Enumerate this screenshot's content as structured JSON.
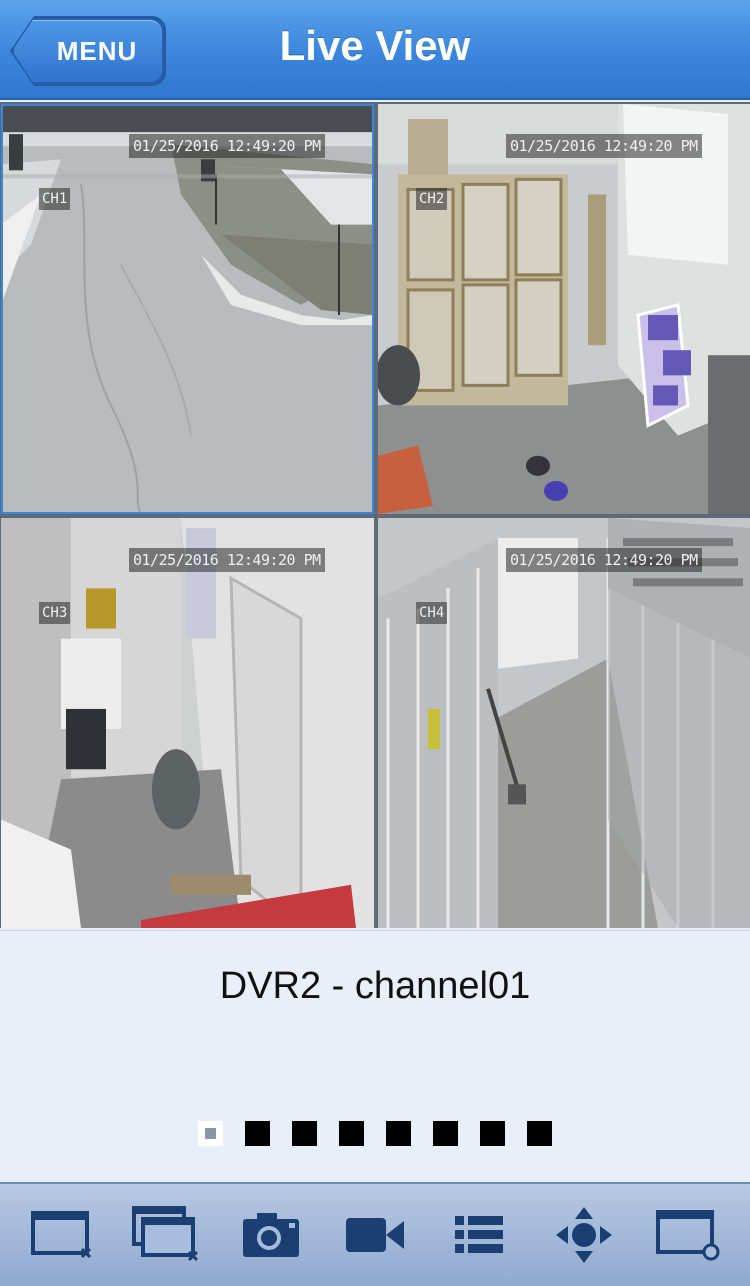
{
  "header": {
    "menu_label": "MENU",
    "title": "Live View"
  },
  "cameras": [
    {
      "timestamp": "01/25/2016 12:49:20 PM",
      "channel": "CH1"
    },
    {
      "timestamp": "01/25/2016 12:49:20 PM",
      "channel": "CH2"
    },
    {
      "timestamp": "01/25/2016 12:49:20 PM",
      "channel": "CH3"
    },
    {
      "timestamp": "01/25/2016 12:49:20 PM",
      "channel": "CH4"
    }
  ],
  "info": {
    "channel_name": "DVR2 - channel01",
    "page_count": 8,
    "active_page": 1
  },
  "toolbar": {
    "icons": [
      "close-window-icon",
      "close-all-windows-icon",
      "snapshot-camera-icon",
      "record-video-icon",
      "channel-list-icon",
      "ptz-control-icon",
      "window-settings-icon"
    ]
  },
  "colors": {
    "header": "#3b86dc",
    "toolbar": "#a6bcdc",
    "icon": "#1b3f73",
    "background": "#e9eff9"
  }
}
